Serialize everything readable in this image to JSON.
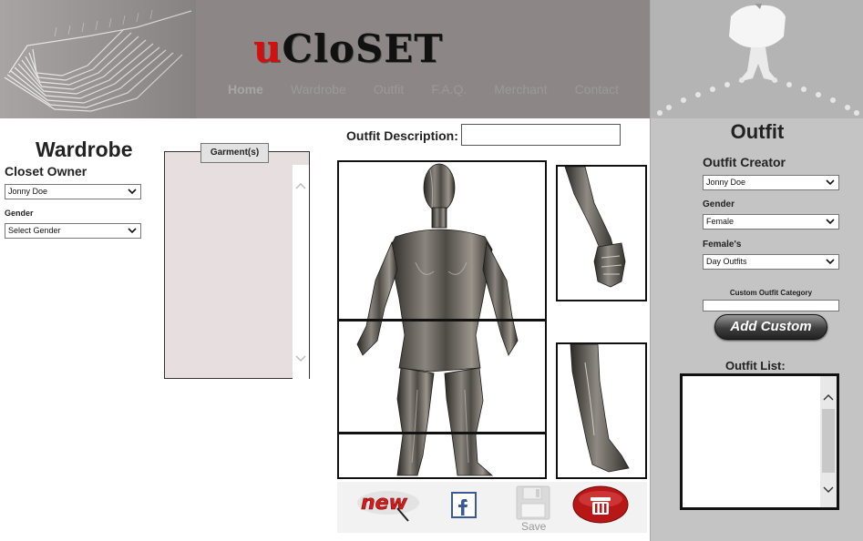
{
  "header": {
    "logo_u": "u",
    "logo_rest": "CloSET",
    "nav": [
      "Home",
      "Wardrobe",
      "Outfit",
      "F.A.Q.",
      "Merchant",
      "Contact"
    ]
  },
  "wardrobe": {
    "title": "Wardrobe",
    "closet_owner_label": "Closet Owner",
    "closet_owner_value": "Jonny Doe",
    "gender_label": "Gender",
    "gender_value": "Select Gender",
    "garments_tab": "Garment(s)"
  },
  "outfit_editor": {
    "description_label": "Outfit Description:",
    "description_value": "",
    "save_label": "Save"
  },
  "outfit_panel": {
    "title": "Outfit",
    "creator_label": "Outfit Creator",
    "creator_value": "Jonny Doe",
    "gender_label": "Gender",
    "gender_value": "Female",
    "category_label": "Female's",
    "category_value": "Day Outfits",
    "custom_label": "Custom Outfit Category",
    "custom_value": "",
    "add_custom_button": "Add Custom",
    "outfit_list_label": "Outfit List:"
  },
  "colors": {
    "header_bg": "#8c8686",
    "logo_accent": "#d21010",
    "right_panel_bg": "#c4c4c4",
    "garment_box_bg": "#e7dfdf"
  },
  "icons": [
    "new-icon",
    "facebook-icon",
    "save-floppy-icon",
    "delete-icon",
    "chevron-down-icon",
    "scroll-up-icon",
    "scroll-down-icon"
  ]
}
